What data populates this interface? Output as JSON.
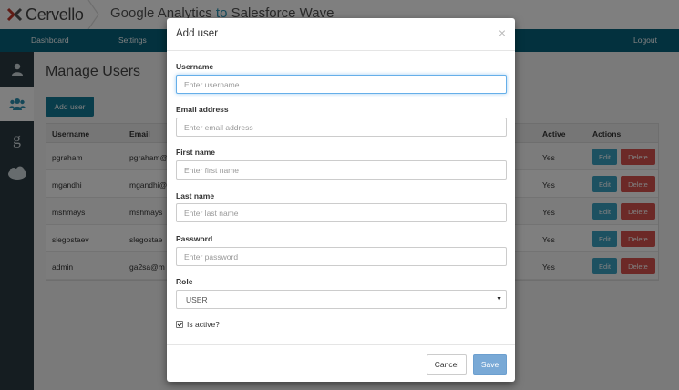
{
  "header": {
    "brand": "Cervello",
    "title_part1": "Google Analytics",
    "title_to": "to",
    "title_part2": "Salesforce Wave"
  },
  "nav": {
    "dashboard": "Dashboard",
    "settings": "Settings",
    "logout": "Logout"
  },
  "sidebar": {
    "items": [
      {
        "icon": "user-icon"
      },
      {
        "icon": "users-icon"
      },
      {
        "icon": "google-icon",
        "glyph": "g"
      },
      {
        "icon": "salesforce-cloud-icon"
      }
    ]
  },
  "page": {
    "title": "Manage Users",
    "add_user_label": "Add user"
  },
  "table": {
    "columns": {
      "username": "Username",
      "email": "Email",
      "active": "Active",
      "actions": "Actions"
    },
    "rows": [
      {
        "username": "pgraham",
        "email": "pgraham@",
        "active": "Yes"
      },
      {
        "username": "mgandhi",
        "email": "mgandhi@",
        "active": "Yes"
      },
      {
        "username": "mshmays",
        "email": "mshmays",
        "active": "Yes"
      },
      {
        "username": "slegostaev",
        "email": "slegostae",
        "active": "Yes"
      },
      {
        "username": "admin",
        "email": "ga2sa@m",
        "active": "Yes"
      }
    ],
    "edit_label": "Edit",
    "delete_label": "Delete"
  },
  "modal": {
    "title": "Add user",
    "close": "×",
    "username_label": "Username",
    "username_placeholder": "Enter username",
    "email_label": "Email address",
    "email_placeholder": "Enter email address",
    "first_label": "First name",
    "first_placeholder": "Enter first name",
    "last_label": "Last name",
    "last_placeholder": "Enter last name",
    "password_label": "Password",
    "password_placeholder": "Enter password",
    "role_label": "Role",
    "role_value": "USER",
    "is_active_label": "Is active?",
    "is_active_checked": true,
    "cancel_label": "Cancel",
    "save_label": "Save"
  },
  "colors": {
    "nav_bg": "#06627d",
    "sidebar_bg": "#2b3a42",
    "accent": "#127a96",
    "delete": "#d9534f",
    "save": "#79a9d6"
  }
}
